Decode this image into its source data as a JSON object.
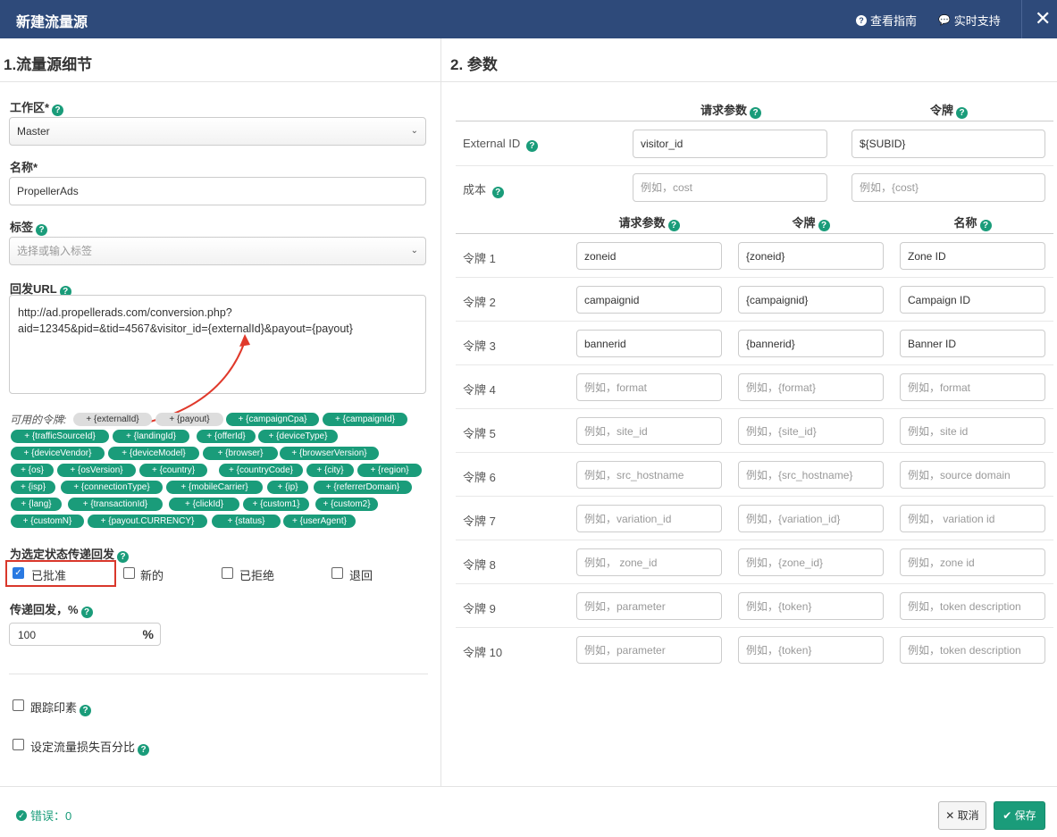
{
  "header": {
    "title": "新建流量源",
    "guide_label": "查看指南",
    "support_label": "实时支持",
    "close_label": "✕"
  },
  "left": {
    "section_title": "1.流量源细节",
    "workspace_label": "工作区*",
    "workspace_value": "Master",
    "name_label": "名称*",
    "name_value": "PropellerAds",
    "tags_label": "标签",
    "tags_placeholder": "选择或输入标签",
    "postback_label": "回发URL",
    "postback_value": "http://ad.propellerads.com/conversion.php?aid=12345&pid=&tid=4567&visitor_id={externalId}&payout={payout}",
    "tokens_label": "可用的令牌:",
    "tokens": [
      "+ {externalId}",
      "+ {payout}",
      "+ {campaignCpa}",
      "+ {campaignId}",
      "+ {trafficSourceId}",
      "+ {landingId}",
      "+ {offerId}",
      "+ {deviceType}",
      "+ {deviceVendor}",
      "+ {deviceModel}",
      "+ {browser}",
      "+ {browserVersion}",
      "+ {os}",
      "+ {osVersion}",
      "+ {country}",
      "+ {countryCode}",
      "+ {city}",
      "+ {region}",
      "+ {isp}",
      "+ {connectionType}",
      "+ {mobileCarrier}",
      "+ {ip}",
      "+ {referrerDomain}",
      "+ {lang}",
      "+ {transactionId}",
      "+ {clickId}",
      "+ {custom1}",
      "+ {custom2}",
      "+ {customN}",
      "+ {payout.CURRENCY}",
      "+ {status}",
      "+ {userAgent}"
    ],
    "status_label": "为选定状态传递回发",
    "statuses": [
      "已批准",
      "新的",
      "已拒绝",
      "退回"
    ],
    "percent_label": "传递回发，%",
    "percent_value": "100",
    "percent_sign": "%",
    "track_impressions_label": "跟踪印素",
    "traffic_loss_label": "设定流量损失百分比"
  },
  "right": {
    "section_title": "2. 参数",
    "top_headers": [
      "请求参数",
      "令牌"
    ],
    "external_id": {
      "label": "External ID",
      "param": "visitor_id",
      "token": "${SUBID}"
    },
    "cost": {
      "label": "成本",
      "param_placeholder": "例如，cost",
      "token_placeholder": "例如，{cost}"
    },
    "token_headers": [
      "请求参数",
      "令牌",
      "名称"
    ],
    "rows": [
      {
        "label": "令牌 1",
        "param": "zoneid",
        "token": "{zoneid}",
        "name": "Zone ID"
      },
      {
        "label": "令牌 2",
        "param": "campaignid",
        "token": "{campaignid}",
        "name": "Campaign ID"
      },
      {
        "label": "令牌 3",
        "param": "bannerid",
        "token": "{bannerid}",
        "name": "Banner ID"
      },
      {
        "label": "令牌 4",
        "param_ph": "例如，format",
        "token_ph": "例如，{format}",
        "name_ph": "例如，format"
      },
      {
        "label": "令牌 5",
        "param_ph": "例如，site_id",
        "token_ph": "例如，{site_id}",
        "name_ph": "例如，site id"
      },
      {
        "label": "令牌 6",
        "param_ph": "例如，src_hostname",
        "token_ph": "例如，{src_hostname}",
        "name_ph": "例如，source domain"
      },
      {
        "label": "令牌 7",
        "param_ph": "例如，variation_id",
        "token_ph": "例如，{variation_id}",
        "name_ph": "例如， variation id"
      },
      {
        "label": "令牌 8",
        "param_ph": "例如， zone_id",
        "token_ph": "例如，{zone_id}",
        "name_ph": "例如，zone id"
      },
      {
        "label": "令牌 9",
        "param_ph": "例如，parameter",
        "token_ph": "例如，{token}",
        "name_ph": "例如，token description"
      },
      {
        "label": "令牌 10",
        "param_ph": "例如，parameter",
        "token_ph": "例如，{token}",
        "name_ph": "例如，token description"
      }
    ]
  },
  "footer": {
    "errors_label": "错误：0",
    "cancel_label": "✕ 取消",
    "save_label": "✔ 保存"
  },
  "colors": {
    "header": "#2e4a7a",
    "accent": "#1a9c7a",
    "highlight": "#d9372b",
    "checkbox": "#2a7ae2"
  }
}
